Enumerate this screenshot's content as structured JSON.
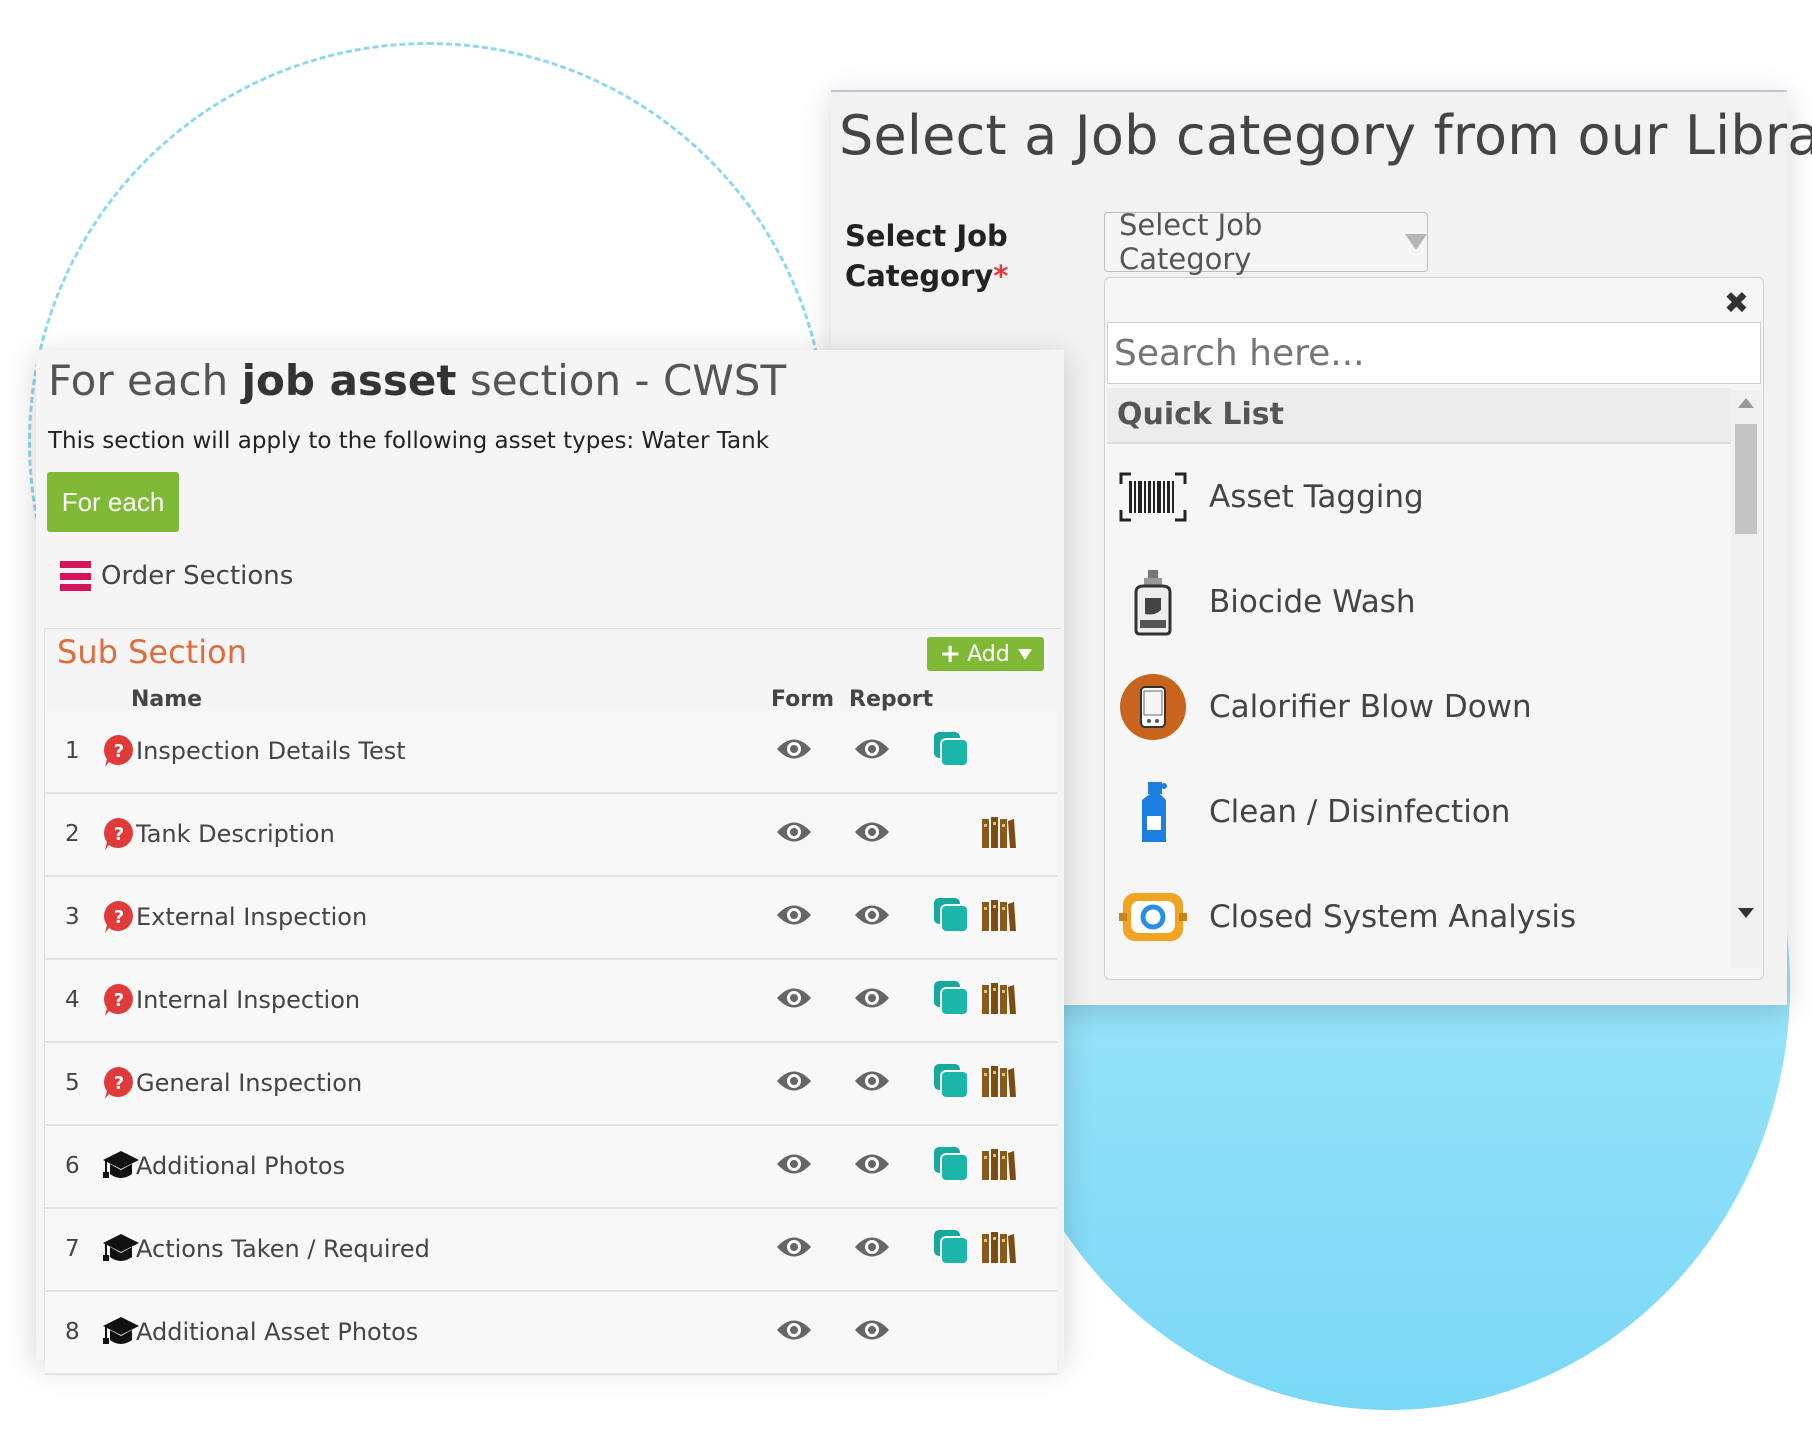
{
  "job_library": {
    "title": "Select a Job category from our Library",
    "field_label": "Select Job Category",
    "required_mark": "*",
    "select_value": "Select Job Category",
    "close_symbol": "✖",
    "search_placeholder": "Search here...",
    "quick_list_header": "Quick List",
    "items": [
      {
        "label": "Asset Tagging",
        "icon": "barcode-icon"
      },
      {
        "label": "Biocide Wash",
        "icon": "biocide-bottle-icon"
      },
      {
        "label": "Calorifier Blow Down",
        "icon": "calorifier-icon"
      },
      {
        "label": "Clean / Disinfection",
        "icon": "spray-bottle-icon"
      },
      {
        "label": "Closed System Analysis",
        "icon": "closed-system-icon"
      }
    ]
  },
  "asset_section": {
    "title_prefix": "For each ",
    "title_bold": "job asset",
    "title_suffix": " section - CWST",
    "description": "This section will apply to the following asset types: Water Tank",
    "for_each_button": "For each",
    "order_sections_label": "Order Sections",
    "subsection": {
      "title": "Sub Section",
      "add_button": "Add",
      "columns": {
        "name": "Name",
        "form": "Form",
        "report": "Report"
      },
      "rows": [
        {
          "num": "1",
          "name": "Inspection Details Test",
          "icon": "question-icon",
          "copy": true,
          "library": false
        },
        {
          "num": "2",
          "name": "Tank Description",
          "icon": "question-icon",
          "copy": false,
          "library": true
        },
        {
          "num": "3",
          "name": "External Inspection",
          "icon": "question-icon",
          "copy": true,
          "library": true
        },
        {
          "num": "4",
          "name": "Internal Inspection",
          "icon": "question-icon",
          "copy": true,
          "library": true
        },
        {
          "num": "5",
          "name": "General Inspection",
          "icon": "question-icon",
          "copy": true,
          "library": true
        },
        {
          "num": "6",
          "name": "Additional Photos",
          "icon": "graduation-cap-icon",
          "copy": true,
          "library": true
        },
        {
          "num": "7",
          "name": "Actions Taken / Required",
          "icon": "graduation-cap-icon",
          "copy": true,
          "library": true
        },
        {
          "num": "8",
          "name": "Additional Asset Photos",
          "icon": "graduation-cap-icon",
          "copy": false,
          "library": false
        }
      ]
    }
  },
  "colors": {
    "accent_green": "#7fb935",
    "subsection_title": "#e06c3c",
    "order_icon": "#d6145e",
    "copy_icon": "#17a89e",
    "library_icon": "#8a5a1c",
    "question_icon": "#e03a3a",
    "blob": "#7ad8f7",
    "dashed_circle": "#8fd8ee"
  }
}
